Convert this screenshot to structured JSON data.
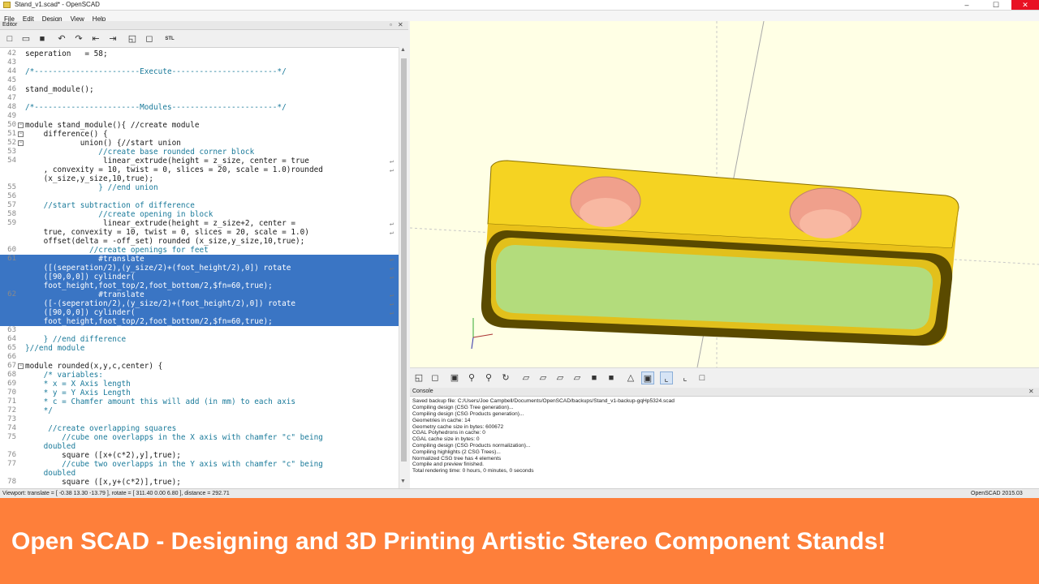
{
  "window": {
    "title": "Stand_v1.scad* - OpenSCAD",
    "controls": [
      "–",
      "☐",
      "✕"
    ]
  },
  "menu": [
    "File",
    "Edit",
    "Design",
    "View",
    "Help"
  ],
  "editor": {
    "title": "Editor",
    "close": "✕",
    "float": "▫",
    "toolbar_stl": "STL",
    "lines": [
      {
        "n": "42",
        "code": "seperation   = 58;",
        "type": "code"
      },
      {
        "n": "43",
        "code": "",
        "type": "code"
      },
      {
        "n": "44",
        "code": "/*-----------------------Execute-----------------------*/",
        "type": "comment"
      },
      {
        "n": "45",
        "code": "",
        "type": "code"
      },
      {
        "n": "46",
        "code": "stand_module();",
        "type": "code"
      },
      {
        "n": "47",
        "code": "",
        "type": "code"
      },
      {
        "n": "48",
        "code": "/*-----------------------Modules-----------------------*/",
        "type": "comment"
      },
      {
        "n": "49",
        "code": "",
        "type": "code"
      },
      {
        "n": "50",
        "code": "module stand_module(){ //create module",
        "type": "code",
        "fold": true
      },
      {
        "n": "51",
        "code": "    difference() {",
        "type": "code",
        "fold": true
      },
      {
        "n": "52",
        "code": "            union() {//start union",
        "type": "code",
        "fold": true
      },
      {
        "n": "53",
        "code": "                //create base rounded corner block",
        "type": "comment"
      },
      {
        "n": "54",
        "code": "                 linear_extrude(height = z_size, center = true",
        "type": "code",
        "wrap": true
      },
      {
        "n": "",
        "code": "    , convexity = 10, twist = 0, slices = 20, scale = 1.0)rounded",
        "type": "code",
        "wrap": true
      },
      {
        "n": "",
        "code": "    (x_size,y_size,10,true);",
        "type": "code"
      },
      {
        "n": "55",
        "code": "                } //end union",
        "type": "comment"
      },
      {
        "n": "56",
        "code": "",
        "type": "code"
      },
      {
        "n": "57",
        "code": "    //start subtraction of difference",
        "type": "comment"
      },
      {
        "n": "58",
        "code": "                //create opening in block",
        "type": "comment"
      },
      {
        "n": "59",
        "code": "                 linear_extrude(height = z_size+2, center =",
        "type": "code",
        "wrap": true
      },
      {
        "n": "",
        "code": "    true, convexity = 10, twist = 0, slices = 20, scale = 1.0)",
        "type": "code",
        "wrap": true
      },
      {
        "n": "",
        "code": "    offset(delta = -off_set) rounded (x_size,y_size,10,true);",
        "type": "code"
      },
      {
        "n": "60",
        "code": "              //create openings for feet",
        "type": "comment"
      },
      {
        "n": "61",
        "code": "                #translate",
        "type": "hl",
        "wrap": true
      },
      {
        "n": "",
        "code": "    ([(seperation/2),(y_size/2)+(foot_height/2),0]) rotate",
        "type": "hl",
        "wrap": true
      },
      {
        "n": "",
        "code": "    ([90,0,0]) cylinder(",
        "type": "hl",
        "wrap": true
      },
      {
        "n": "",
        "code": "    foot_height,foot_top/2,foot_bottom/2,$fn=60,true);",
        "type": "hl"
      },
      {
        "n": "62",
        "code": "                #translate",
        "type": "hl",
        "wrap": true
      },
      {
        "n": "",
        "code": "    ([-(seperation/2),(y_size/2)+(foot_height/2),0]) rotate",
        "type": "hl",
        "wrap": true
      },
      {
        "n": "",
        "code": "    ([90,0,0]) cylinder(",
        "type": "hl",
        "wrap": true
      },
      {
        "n": "",
        "code": "    foot_height,foot_top/2,foot_bottom/2,$fn=60,true);",
        "type": "hl"
      },
      {
        "n": "63",
        "code": "",
        "type": "code"
      },
      {
        "n": "64",
        "code": "    } //end difference",
        "type": "comment"
      },
      {
        "n": "65",
        "code": "}//end module",
        "type": "comment"
      },
      {
        "n": "66",
        "code": "",
        "type": "code"
      },
      {
        "n": "67",
        "code": "module rounded(x,y,c,center) {",
        "type": "code",
        "fold": true
      },
      {
        "n": "68",
        "code": "    /* variables:",
        "type": "comment"
      },
      {
        "n": "69",
        "code": "    * x = X Axis length",
        "type": "comment"
      },
      {
        "n": "70",
        "code": "    * y = Y Axis Length",
        "type": "comment"
      },
      {
        "n": "71",
        "code": "    * c = Chamfer amount this will add (in mm) to each axis",
        "type": "comment"
      },
      {
        "n": "72",
        "code": "    */",
        "type": "comment"
      },
      {
        "n": "73",
        "code": "",
        "type": "code"
      },
      {
        "n": "74",
        "code": "     //create overlapping squares",
        "type": "comment"
      },
      {
        "n": "75",
        "code": "        //cube one overlapps in the X axis with chamfer \"c\" being",
        "type": "comment"
      },
      {
        "n": "",
        "code": "    doubled",
        "type": "comment"
      },
      {
        "n": "76",
        "code": "        square ([x+(c*2),y],true);",
        "type": "code"
      },
      {
        "n": "77",
        "code": "        //cube two overlapps in the Y axis with chamfer \"c\" being",
        "type": "comment"
      },
      {
        "n": "",
        "code": "    doubled",
        "type": "comment"
      },
      {
        "n": "78",
        "code": "        square ([x,y+(c*2)],true);",
        "type": "code"
      }
    ]
  },
  "console": {
    "title": "Console",
    "close": "✕",
    "lines": [
      "Saved backup file: C:/Users/Joe Campbell/Documents/OpenSCAD/backups/Stand_v1-backup-gqHp5324.scad",
      "Compiling design (CSG Tree generation)...",
      "Compiling design (CSG Products generation)...",
      "Geometries in cache: 14",
      "Geometry cache size in bytes: 600672",
      "CGAL Polyhedrons in cache: 0",
      "CGAL cache size in bytes: 0",
      "Compiling design (CSG Products normalization)...",
      "Compiling highlights (2 CSG Trees)...",
      "Normalized CSG tree has 4 elements",
      "Compile and preview finished.",
      "Total rendering time: 0 hours, 0 minutes, 0 seconds"
    ]
  },
  "status": {
    "viewport": "Viewport: translate = [ -0.38 13.30 -13.79 ], rotate = [ 311.40 0.00 6.80 ], distance = 292.71",
    "version": "OpenSCAD 2015.03"
  },
  "banner": {
    "text": "Open SCAD - Designing and 3D Printing Artistic Stereo Component Stands!",
    "color": "#fe7f3a"
  },
  "colors": {
    "model_yellow": "#f5d322",
    "model_dark": "#5a4a00",
    "model_inner": "#b3dc7c",
    "highlight_hole": "#f0a08c",
    "viewport_bg": "#ffffe5",
    "selection": "#3a75c4"
  }
}
